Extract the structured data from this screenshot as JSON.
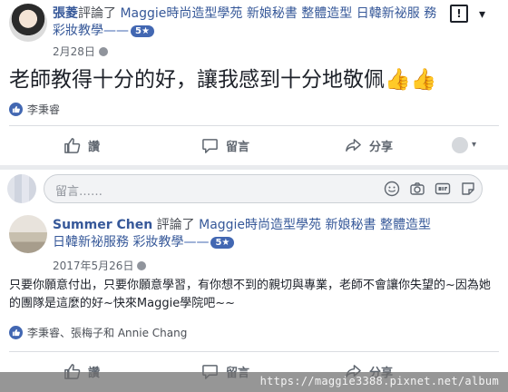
{
  "post1": {
    "author": "張菱",
    "action_text": "評論了",
    "page_name_line1": "Maggie時尚造型學苑 新娘秘書 整體造型 日韓新祕服",
    "page_name_line2": "務 彩妝教學",
    "dash": "——",
    "rating": "5★",
    "date": "2月28日",
    "body": "老師教得十分的好，讓我感到十分地敬佩👍👍",
    "reactions": "李秉睿",
    "like_label": "讚",
    "comment_label": "留言",
    "share_label": "分享"
  },
  "comment_box": {
    "placeholder": "留言……",
    "icons": [
      "smiley-icon",
      "camera-icon",
      "gif-icon",
      "sticker-icon"
    ]
  },
  "post2": {
    "author": "Summer Chen",
    "action_text": "評論了",
    "page_name_line1": "Maggie時尚造型學苑 新娘秘書 整體造型",
    "page_name_line2": "日韓新祕服務 彩妝教學",
    "dash": "——",
    "rating": "5★",
    "date": "2017年5月26日",
    "body": "只要你願意付出，只要你願意學習，有你想不到的親切與專業，老師不會讓你失望的~因為她的團隊是這麼的好~快來Maggie學院吧~~",
    "reactions": "李秉睿、張梅子和 Annie Chang",
    "like_label": "讚",
    "comment_label": "留言",
    "share_label": "分享"
  },
  "flag_glyph": "!",
  "chevron_glyph": "▾",
  "watermark": "https://maggie3388.pixnet.net/album",
  "colors": {
    "link": "#365899",
    "badge": "#4267b2",
    "separator": "#e9ebee"
  }
}
